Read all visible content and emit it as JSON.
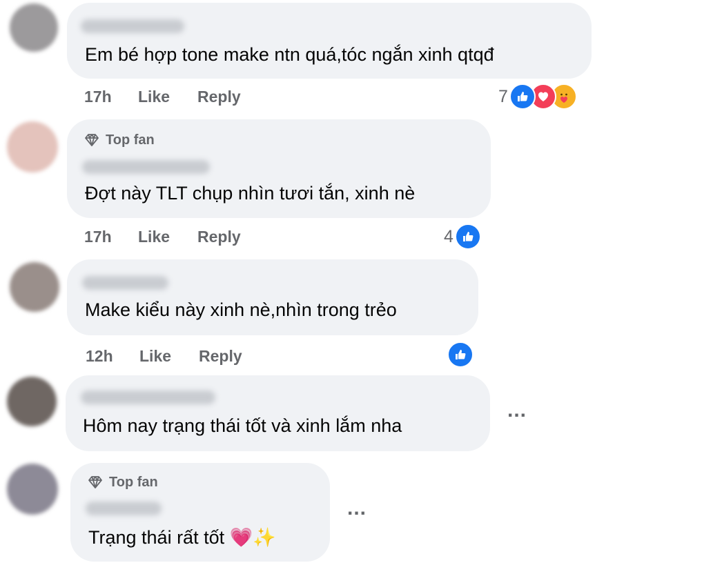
{
  "labels": {
    "top_fan": "Top fan",
    "like": "Like",
    "reply": "Reply"
  },
  "comments": [
    {
      "text": "Em bé hợp tone make ntn quá,tóc ngắn xinh qtqđ",
      "time": "17h",
      "reaction_count": "7",
      "reactions": [
        "like-icon",
        "love-icon",
        "care-icon"
      ]
    },
    {
      "badge": "Top fan",
      "text": "Đợt này TLT chụp nhìn tươi tắn, xinh nè",
      "time": "17h",
      "reaction_count": "4",
      "reactions": [
        "like-icon"
      ]
    },
    {
      "text": "Make kiểu này xinh nè,nhìn trong trẻo",
      "time": "12h",
      "reactions": [
        "like-icon"
      ]
    },
    {
      "text": "Hôm nay trạng thái tốt và xinh lắm nha",
      "more": "..."
    },
    {
      "badge": "Top fan",
      "text": "Trạng thái rất tốt 💗✨",
      "more": "..."
    }
  ],
  "colors": {
    "bubble": "#f0f2f5",
    "secondary_text": "#65676b",
    "like_blue": "#1877f2",
    "love_red": "#f33e58",
    "care_yellow": "#f7b125"
  }
}
